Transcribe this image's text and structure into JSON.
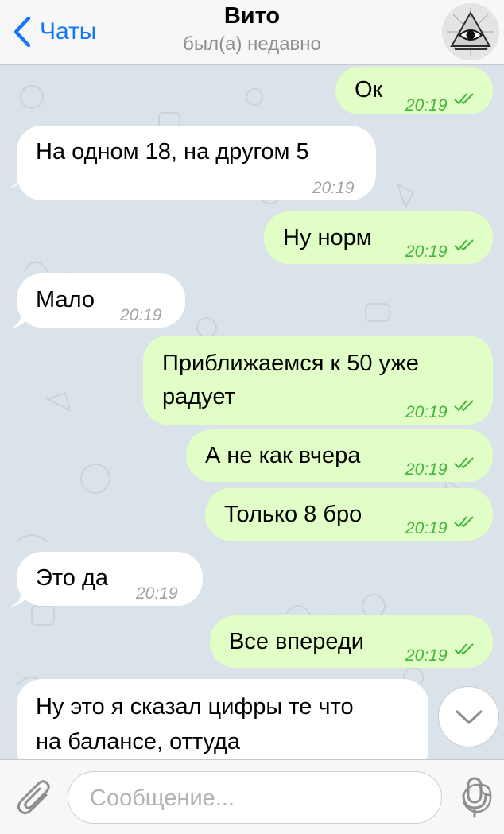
{
  "header": {
    "back_label": "Чаты",
    "title": "Вито",
    "status": "был(а) недавно"
  },
  "messages": [
    {
      "direction": "out",
      "text": "Ок",
      "time": "20:19",
      "read": true
    },
    {
      "direction": "in",
      "text": "На одном 18, на другом 5",
      "time": "20:19"
    },
    {
      "direction": "out",
      "text": "Ну норм",
      "time": "20:19",
      "read": true
    },
    {
      "direction": "in",
      "text": "Мало",
      "time": "20:19"
    },
    {
      "direction": "out",
      "lines": [
        "Приближаемся к 50 уже",
        "радует"
      ],
      "time": "20:19",
      "read": true
    },
    {
      "direction": "out",
      "text": "А не как вчера",
      "time": "20:19",
      "read": true
    },
    {
      "direction": "out",
      "text": "Только 8 бро",
      "time": "20:19",
      "read": true
    },
    {
      "direction": "in",
      "text": "Это да",
      "time": "20:19"
    },
    {
      "direction": "out",
      "text": "Все впереди",
      "time": "20:19",
      "read": true
    },
    {
      "direction": "in",
      "lines": [
        "Ну это я сказал цифры те что",
        "на балансе, оттуда"
      ]
    }
  ],
  "input": {
    "placeholder": "Сообщение..."
  },
  "colors": {
    "accent": "#1478f6",
    "outgoing_bubble": "#e1fec6",
    "incoming_bubble": "#ffffff",
    "chat_background": "#dbe3ea",
    "read_check": "#42b53d"
  },
  "icons": {
    "back": "chevron-left-icon",
    "scroll_down": "chevron-down-icon",
    "attach": "paperclip-icon",
    "sticker": "sticker-icon",
    "mic": "microphone-icon",
    "read": "double-check-icon"
  }
}
